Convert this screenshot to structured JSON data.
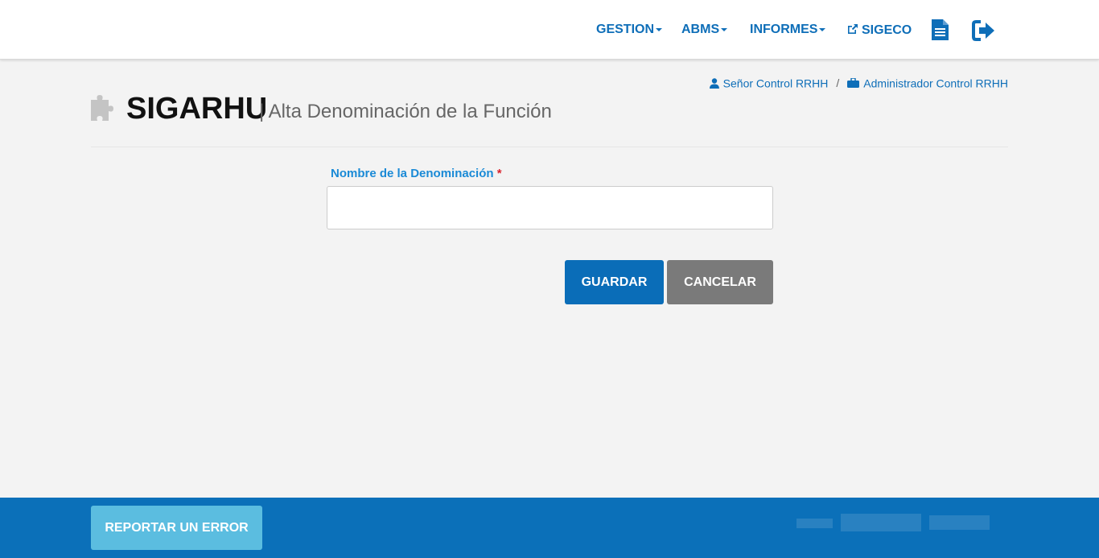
{
  "nav": {
    "gestion": "GESTION",
    "abms": "ABMS",
    "informes": "INFORMES",
    "sigeco": "SIGECO",
    "icons": [
      "external-link-icon",
      "document-icon",
      "logout-icon"
    ]
  },
  "breadcrumb": {
    "user": "Señor Control RRHH",
    "separator": "/",
    "role": "Administrador Control RRHH"
  },
  "header": {
    "app_name": "SIGARHU",
    "subtitle": "| Alta Denominación de la Función"
  },
  "form": {
    "label": "Nombre de la Denominación",
    "required_mark": "*",
    "value": "",
    "placeholder": ""
  },
  "actions": {
    "save": "GUARDAR",
    "cancel": "CANCELAR"
  },
  "footer": {
    "report": "REPORTAR UN ERROR"
  },
  "colors": {
    "primary": "#0a6db8",
    "label": "#1a8ad6",
    "cancel": "#7a7a7a",
    "report": "#5bbde0",
    "footer": "#0b70b9",
    "required": "#d9232d"
  }
}
